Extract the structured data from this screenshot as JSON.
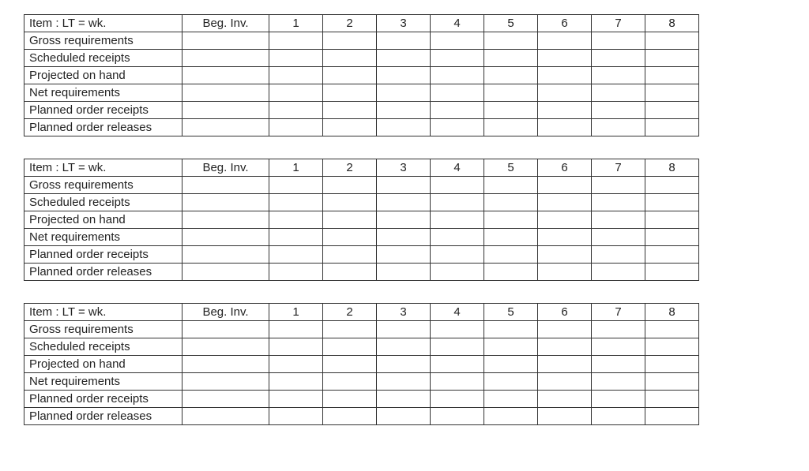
{
  "header_label_parts": [
    "Item",
    "  : LT =",
    "wk."
  ],
  "beg_inv_label": "Beg. Inv.",
  "week_numbers": [
    "1",
    "2",
    "3",
    "4",
    "5",
    "6",
    "7",
    "8"
  ],
  "row_labels": [
    "Gross requirements",
    "Scheduled receipts",
    "Projected on hand",
    "Net requirements",
    "Planned order receipts",
    "Planned order releases"
  ],
  "tables": [
    {
      "item": "",
      "lt": "",
      "beg_inv": "",
      "rows": [
        {
          "values": [
            "",
            "",
            "",
            "",
            "",
            "",
            "",
            ""
          ]
        },
        {
          "values": [
            "",
            "",
            "",
            "",
            "",
            "",
            "",
            ""
          ]
        },
        {
          "values": [
            "",
            "",
            "",
            "",
            "",
            "",
            "",
            ""
          ]
        },
        {
          "values": [
            "",
            "",
            "",
            "",
            "",
            "",
            "",
            ""
          ]
        },
        {
          "values": [
            "",
            "",
            "",
            "",
            "",
            "",
            "",
            ""
          ]
        },
        {
          "values": [
            "",
            "",
            "",
            "",
            "",
            "",
            "",
            ""
          ]
        }
      ]
    },
    {
      "item": "",
      "lt": "",
      "beg_inv": "",
      "rows": [
        {
          "values": [
            "",
            "",
            "",
            "",
            "",
            "",
            "",
            ""
          ]
        },
        {
          "values": [
            "",
            "",
            "",
            "",
            "",
            "",
            "",
            ""
          ]
        },
        {
          "values": [
            "",
            "",
            "",
            "",
            "",
            "",
            "",
            ""
          ]
        },
        {
          "values": [
            "",
            "",
            "",
            "",
            "",
            "",
            "",
            ""
          ]
        },
        {
          "values": [
            "",
            "",
            "",
            "",
            "",
            "",
            "",
            ""
          ]
        },
        {
          "values": [
            "",
            "",
            "",
            "",
            "",
            "",
            "",
            ""
          ]
        }
      ]
    },
    {
      "item": "",
      "lt": "",
      "beg_inv": "",
      "rows": [
        {
          "values": [
            "",
            "",
            "",
            "",
            "",
            "",
            "",
            ""
          ]
        },
        {
          "values": [
            "",
            "",
            "",
            "",
            "",
            "",
            "",
            ""
          ]
        },
        {
          "values": [
            "",
            "",
            "",
            "",
            "",
            "",
            "",
            ""
          ]
        },
        {
          "values": [
            "",
            "",
            "",
            "",
            "",
            "",
            "",
            ""
          ]
        },
        {
          "values": [
            "",
            "",
            "",
            "",
            "",
            "",
            "",
            ""
          ]
        },
        {
          "values": [
            "",
            "",
            "",
            "",
            "",
            "",
            "",
            ""
          ]
        }
      ]
    }
  ]
}
